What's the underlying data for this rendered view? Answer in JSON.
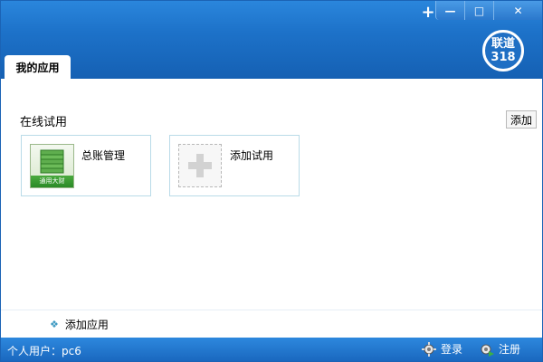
{
  "window": {
    "brand_line1": "联道",
    "brand_line2": "318",
    "titlebar_buttons": {
      "add": "+",
      "minimize": "—",
      "maximize": "□",
      "close": "✕"
    }
  },
  "tab": {
    "label": "我的应用"
  },
  "online_trial": {
    "title": "在线试用",
    "add_button_label": "添加",
    "cards": [
      {
        "label": "总账管理",
        "icon": "ledger-icon",
        "icon_caption": "通用大财"
      },
      {
        "label": "添加试用",
        "icon": "add-plus-icon"
      }
    ]
  },
  "footer": {
    "add_app_label": "添加应用",
    "icon": "diamond-icon"
  },
  "statusbar": {
    "user_text": "个人用户：pc6",
    "login_label": "登录",
    "register_label": "注册",
    "login_icon": "gear-icon",
    "register_icon": "gear-arrow-icon"
  },
  "colors": {
    "primary": "#1d72c9",
    "accent": "#3f9ac2",
    "card_border": "#b9dbe8"
  }
}
